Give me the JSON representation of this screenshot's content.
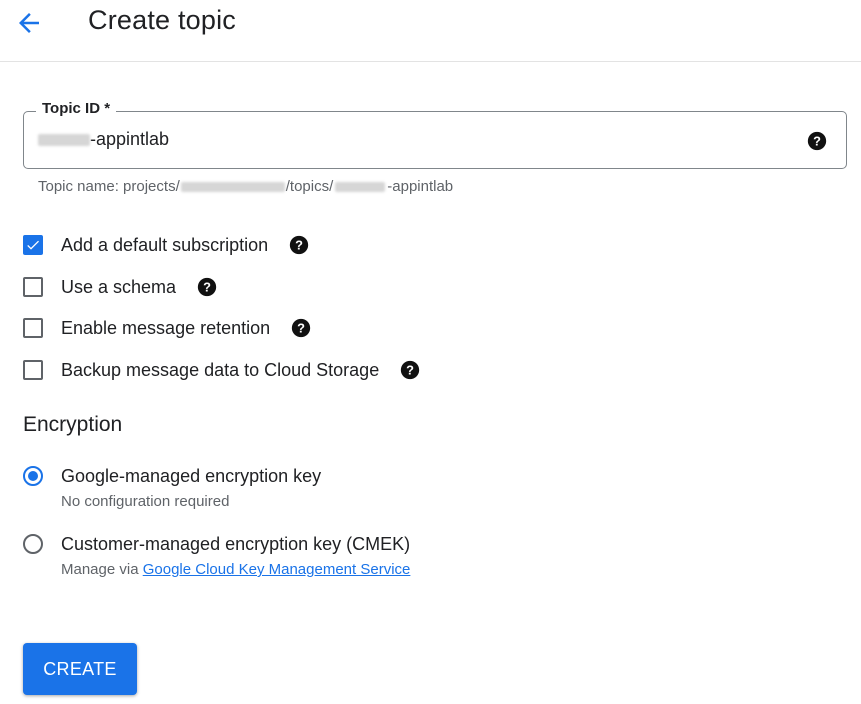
{
  "header": {
    "back_icon": "arrow-back-icon",
    "title": "Create topic"
  },
  "topic_field": {
    "label": "Topic ID *",
    "value_suffix": "-appintlab",
    "help_icon": "help-icon"
  },
  "topic_hint": {
    "prefix": "Topic name: projects/",
    "middle": "/topics/",
    "suffix": "-appintlab"
  },
  "options": [
    {
      "label": "Add a default subscription",
      "checked": true
    },
    {
      "label": "Use a schema",
      "checked": false
    },
    {
      "label": "Enable message retention",
      "checked": false
    },
    {
      "label": "Backup message data to Cloud Storage",
      "checked": false
    }
  ],
  "encryption": {
    "title": "Encryption",
    "google_managed": {
      "label": "Google-managed encryption key",
      "sub": "No configuration required",
      "selected": true
    },
    "customer_managed": {
      "label": "Customer-managed encryption key (CMEK)",
      "sub_prefix": "Manage via ",
      "sub_link": "Google Cloud Key Management Service",
      "selected": false
    }
  },
  "create_button": "CREATE",
  "colors": {
    "accent": "#1a73e8",
    "text": "#202124",
    "secondary_text": "#5f6368"
  }
}
